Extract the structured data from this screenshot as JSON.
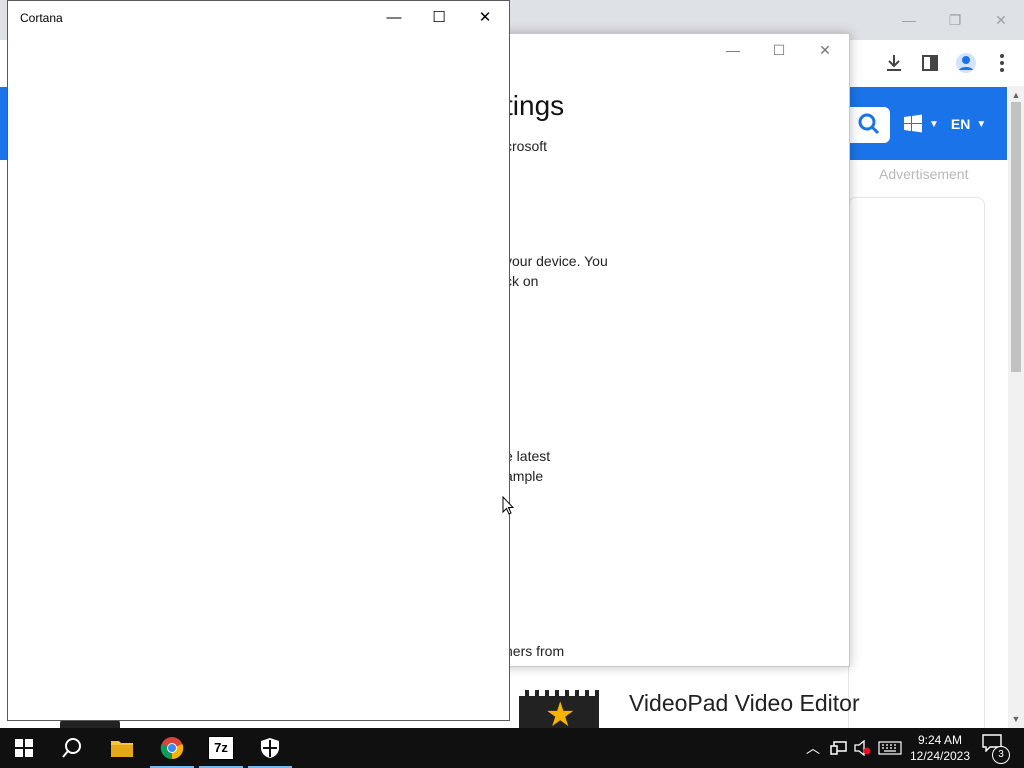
{
  "cortana_window": {
    "title": "Cortana",
    "minimize_glyph": "—",
    "maximize_glyph": "☐",
    "close_glyph": "✕"
  },
  "settings_window": {
    "heading": "tings",
    "lines": [
      "crosoft",
      "your device. You",
      "ck on",
      "e latest",
      "ample",
      "hers from"
    ],
    "minimize_glyph": "—",
    "maximize_glyph": "☐",
    "close_glyph": "✕"
  },
  "browser": {
    "language": "EN",
    "advertisement": "Advertisement",
    "promo_title": "VideoPad Video Editor"
  },
  "taskbar": {
    "time": "9:24 AM",
    "date": "12/24/2023",
    "notification_count": "3",
    "apps": [
      "start-button",
      "search",
      "file-explorer",
      "chrome",
      "7-zip",
      "windows-security"
    ]
  },
  "colors": {
    "accent_blue": "#1a73e8",
    "taskbar": "#101010"
  }
}
